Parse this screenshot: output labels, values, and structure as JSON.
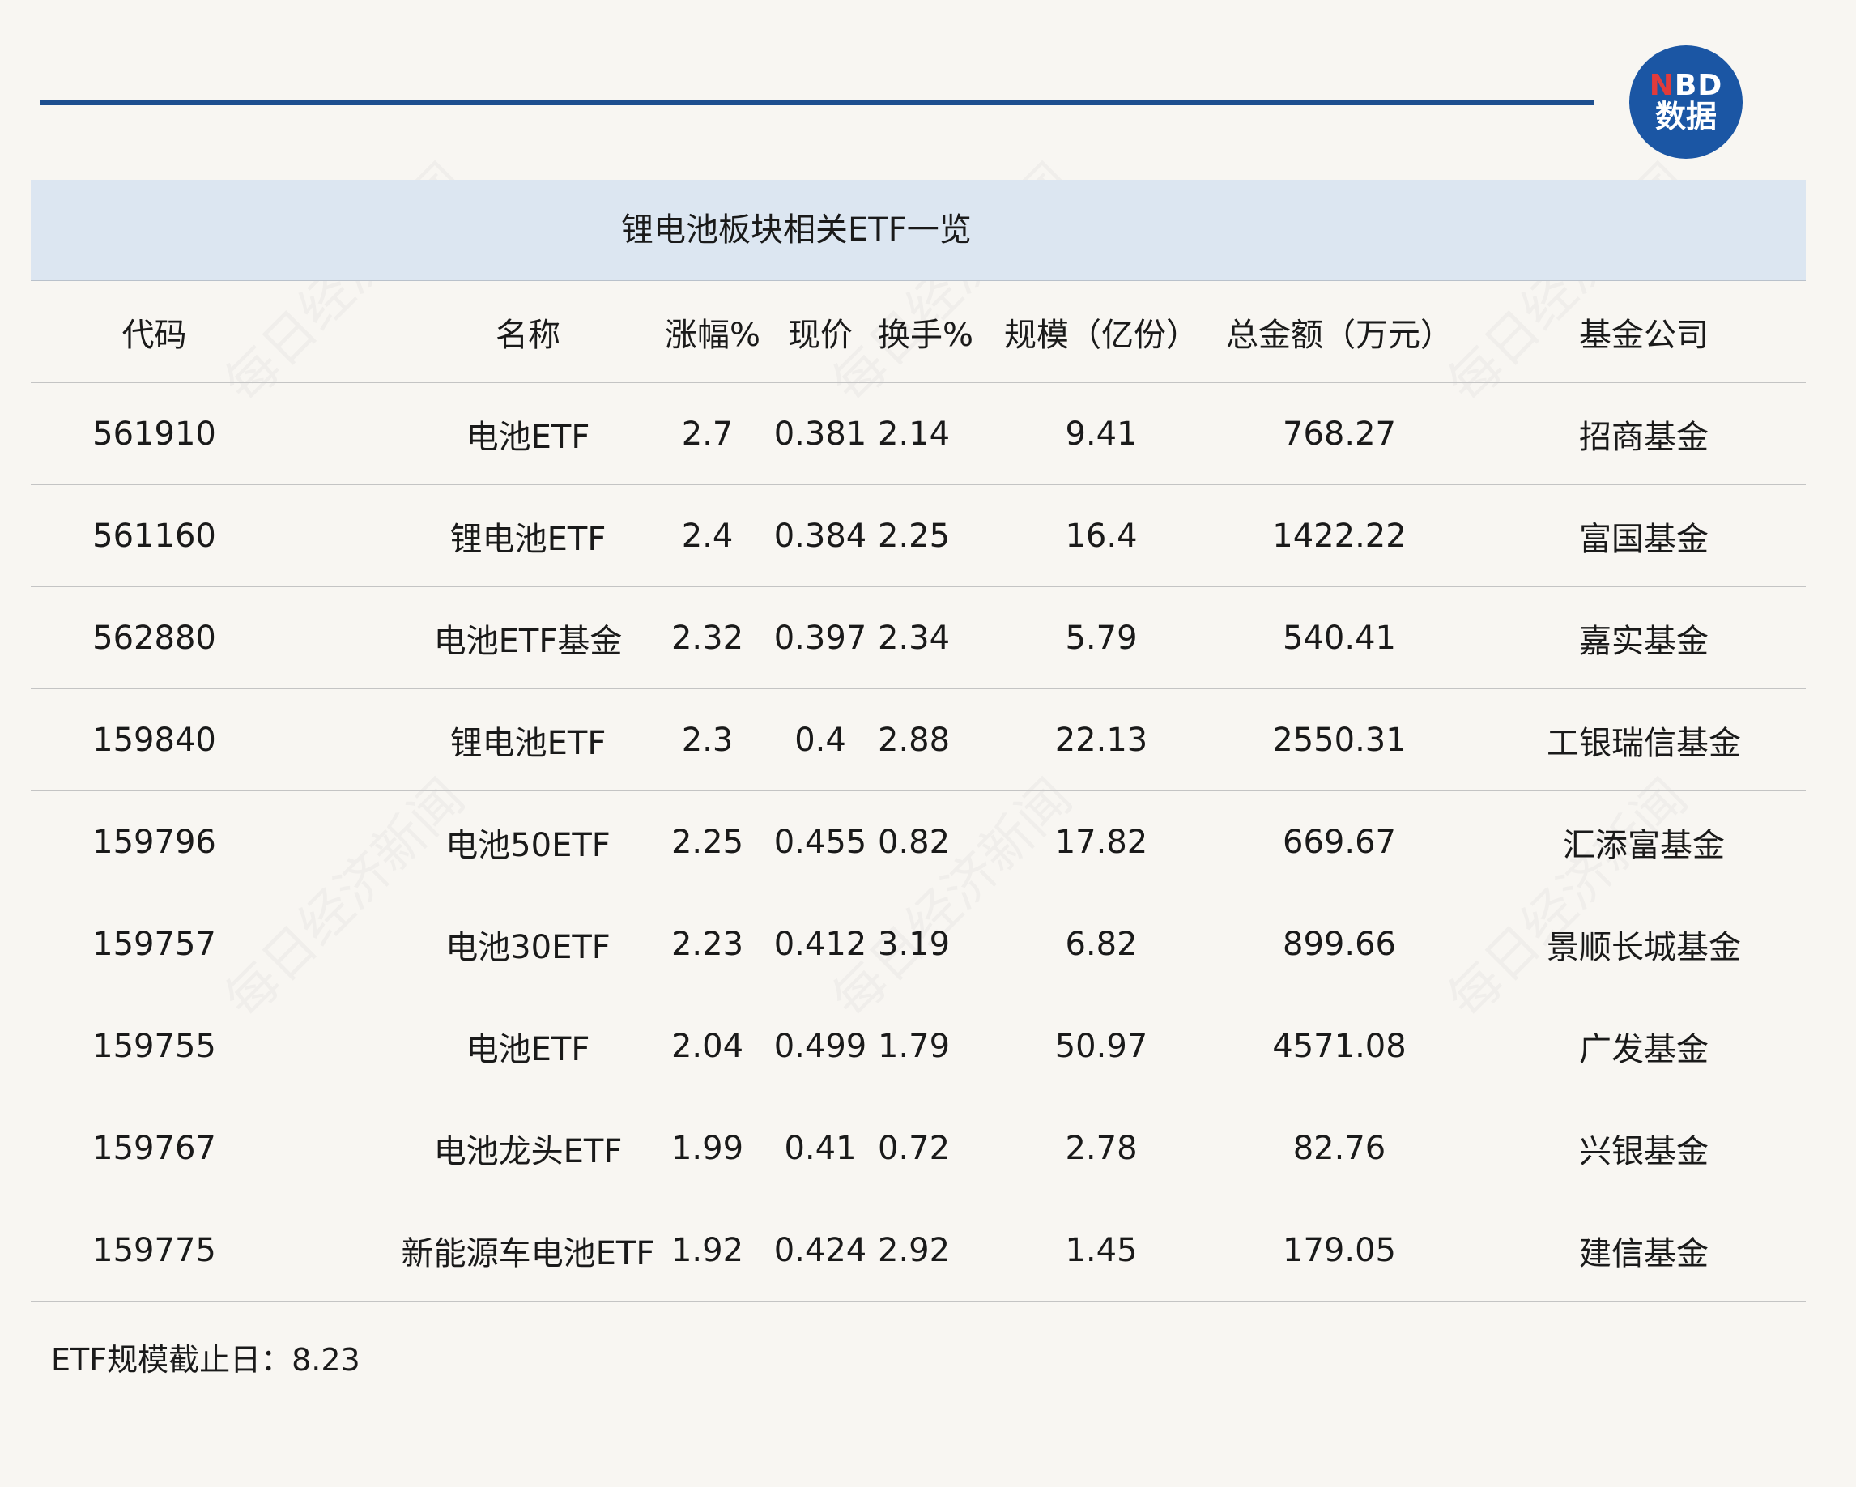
{
  "logo": {
    "line1_n": "N",
    "line1_rest": "BD",
    "line2": "数据"
  },
  "title": "锂电池板块相关ETF一览",
  "headers": [
    "代码",
    "名称",
    "涨幅%",
    "现价",
    "换手%",
    "规模（亿份）",
    "总金额（万元）",
    "基金公司"
  ],
  "rows": [
    [
      "561910",
      "电池ETF",
      "2.7",
      "0.381",
      "2.14",
      "9.41",
      "768.27",
      "招商基金"
    ],
    [
      "561160",
      "锂电池ETF",
      "2.4",
      "0.384",
      "2.25",
      "16.4",
      "1422.22",
      "富国基金"
    ],
    [
      "562880",
      "电池ETF基金",
      "2.32",
      "0.397",
      "2.34",
      "5.79",
      "540.41",
      "嘉实基金"
    ],
    [
      "159840",
      "锂电池ETF",
      "2.3",
      "0.4",
      "2.88",
      "22.13",
      "2550.31",
      "工银瑞信基金"
    ],
    [
      "159796",
      "电池50ETF",
      "2.25",
      "0.455",
      "0.82",
      "17.82",
      "669.67",
      "汇添富基金"
    ],
    [
      "159757",
      "电池30ETF",
      "2.23",
      "0.412",
      "3.19",
      "6.82",
      "899.66",
      "景顺长城基金"
    ],
    [
      "159755",
      "电池ETF",
      "2.04",
      "0.499",
      "1.79",
      "50.97",
      "4571.08",
      "广发基金"
    ],
    [
      "159767",
      "电池龙头ETF",
      "1.99",
      "0.41",
      "0.72",
      "2.78",
      "82.76",
      "兴银基金"
    ],
    [
      "159775",
      "新能源车电池ETF",
      "1.92",
      "0.424",
      "2.92",
      "1.45",
      "179.05",
      "建信基金"
    ]
  ],
  "footnote": "ETF规模截止日：8.23",
  "watermark": "每日经济新闻",
  "colors": {
    "accent": "#1d4f8f",
    "title_band": "#dce6f1",
    "logo_bg": "#1b56a4",
    "logo_n": "#e23b3b"
  }
}
